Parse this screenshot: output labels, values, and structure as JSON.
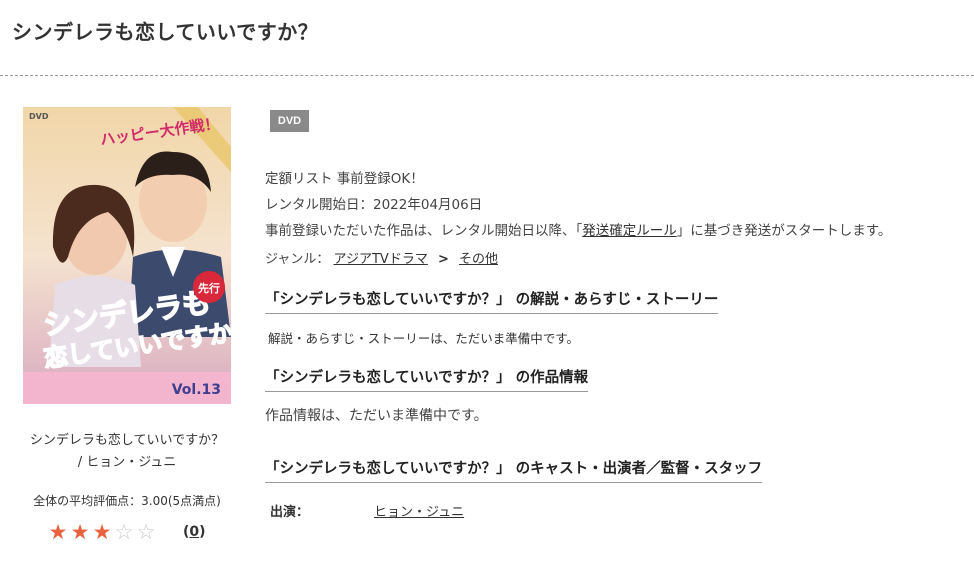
{
  "page": {
    "title": "シンデレラも恋していいですか？"
  },
  "product": {
    "cover_alt": "シンデレラも恋していいですか？ DVD cover",
    "cover_text": {
      "banner": "ハッピー大作戦！",
      "title_line1": "シンデレラも",
      "title_line2": "恋していいですか?",
      "volume": "Vol.13",
      "badge": "先行"
    },
    "caption_title": "シンデレラも恋していいですか？",
    "caption_artist": "/ ヒョン・ジュニ",
    "avg_rating_text": "全体の平均評価点：3.00(5点満点)",
    "rating": 3,
    "rating_max": 5,
    "review_count_open": "(",
    "review_count": "0",
    "review_count_close": ")"
  },
  "details": {
    "badge": "DVD",
    "fixed_list": "定額リスト 事前登録OK！",
    "rental_start": "レンタル開始日：2022年04月06日",
    "preregister_before": "事前登録いただいた作品は、レンタル開始日以降、「",
    "preregister_link": "発送確定ルール",
    "preregister_after": "」に基づき発送がスタートします。",
    "genre_label": "ジャンル：",
    "genre_primary": "アジアTVドラマ",
    "genre_separator": ">",
    "genre_secondary": "その他"
  },
  "sections": {
    "synopsis_heading": "「シンデレラも恋していいですか？」 の解説・あらすじ・ストーリー",
    "synopsis_text": "解説・あらすじ・ストーリーは、ただいま準備中です。",
    "info_heading": "「シンデレラも恋していいですか？」 の作品情報",
    "info_text": "作品情報は、ただいま準備中です。",
    "cast_heading": "「シンデレラも恋していいですか？」 のキャスト・出演者／監督・スタッフ",
    "cast_label": "出演：",
    "cast_value": "ヒョン・ジュニ"
  },
  "colors": {
    "star_full": "#e8623f",
    "star_empty": "#c8c8c8",
    "badge_bg": "#8a8a8a"
  }
}
